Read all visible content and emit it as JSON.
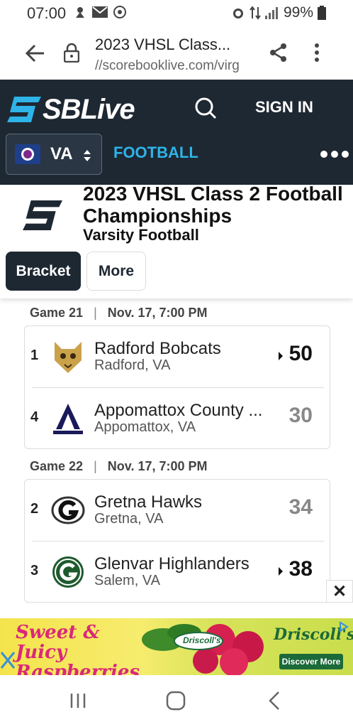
{
  "status": {
    "time": "07:00",
    "battery": "99%"
  },
  "browser": {
    "title": "2023 VHSL Class...",
    "url": "//scorebooklive.com/virg"
  },
  "nav": {
    "brand": "SBLive",
    "signin": "SIGN IN",
    "state": "VA",
    "sport": "FOOTBALL"
  },
  "event": {
    "title": "2023 VHSL Class 2 Football Championships",
    "subtitle": "Varsity Football",
    "tabs": [
      "Bracket",
      "More"
    ]
  },
  "games": [
    {
      "label": "Game 21",
      "date": "Nov. 17, 7:00 PM",
      "teams": [
        {
          "seed": "1",
          "name": "Radford Bobcats",
          "location": "Radford, VA",
          "score": "50",
          "winner": true
        },
        {
          "seed": "4",
          "name": "Appomattox County ...",
          "location": "Appomattox, VA",
          "score": "30",
          "winner": false
        }
      ]
    },
    {
      "label": "Game 22",
      "date": "Nov. 17, 7:00 PM",
      "teams": [
        {
          "seed": "2",
          "name": "Gretna Hawks",
          "location": "Gretna, VA",
          "score": "34",
          "winner": false
        },
        {
          "seed": "3",
          "name": "Glenvar Highlanders",
          "location": "Salem, VA",
          "score": "38",
          "winner": true
        }
      ]
    }
  ],
  "ad": {
    "headline": "Sweet & Juicy Raspberries",
    "brand": "Driscoll's",
    "cta": "Discover More",
    "close": "✕"
  },
  "colors": {
    "navbar": "#1e2833",
    "accent": "#2eb4e8",
    "tab_active": "#1e2833",
    "loser_score": "#888888"
  }
}
